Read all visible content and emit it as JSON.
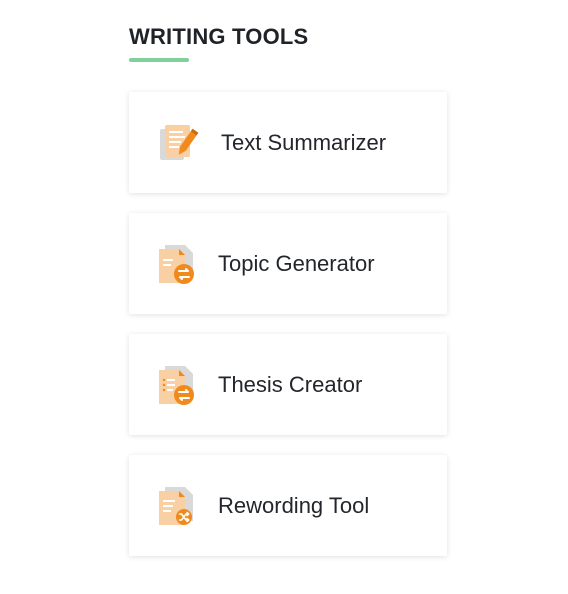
{
  "section": {
    "title": "WRITING TOOLS"
  },
  "tools": [
    {
      "label": "Text Summarizer",
      "icon": "document-pen-icon"
    },
    {
      "label": "Topic Generator",
      "icon": "document-swap-icon"
    },
    {
      "label": "Thesis Creator",
      "icon": "document-list-swap-icon"
    },
    {
      "label": "Rewording Tool",
      "icon": "document-shuffle-icon"
    }
  ],
  "colors": {
    "accent_underline": "#7fd09a",
    "icon_orange": "#f08a1c",
    "icon_peach": "#f9cfa4",
    "icon_gray": "#d6d6d6",
    "title_text": "#1f2328"
  }
}
